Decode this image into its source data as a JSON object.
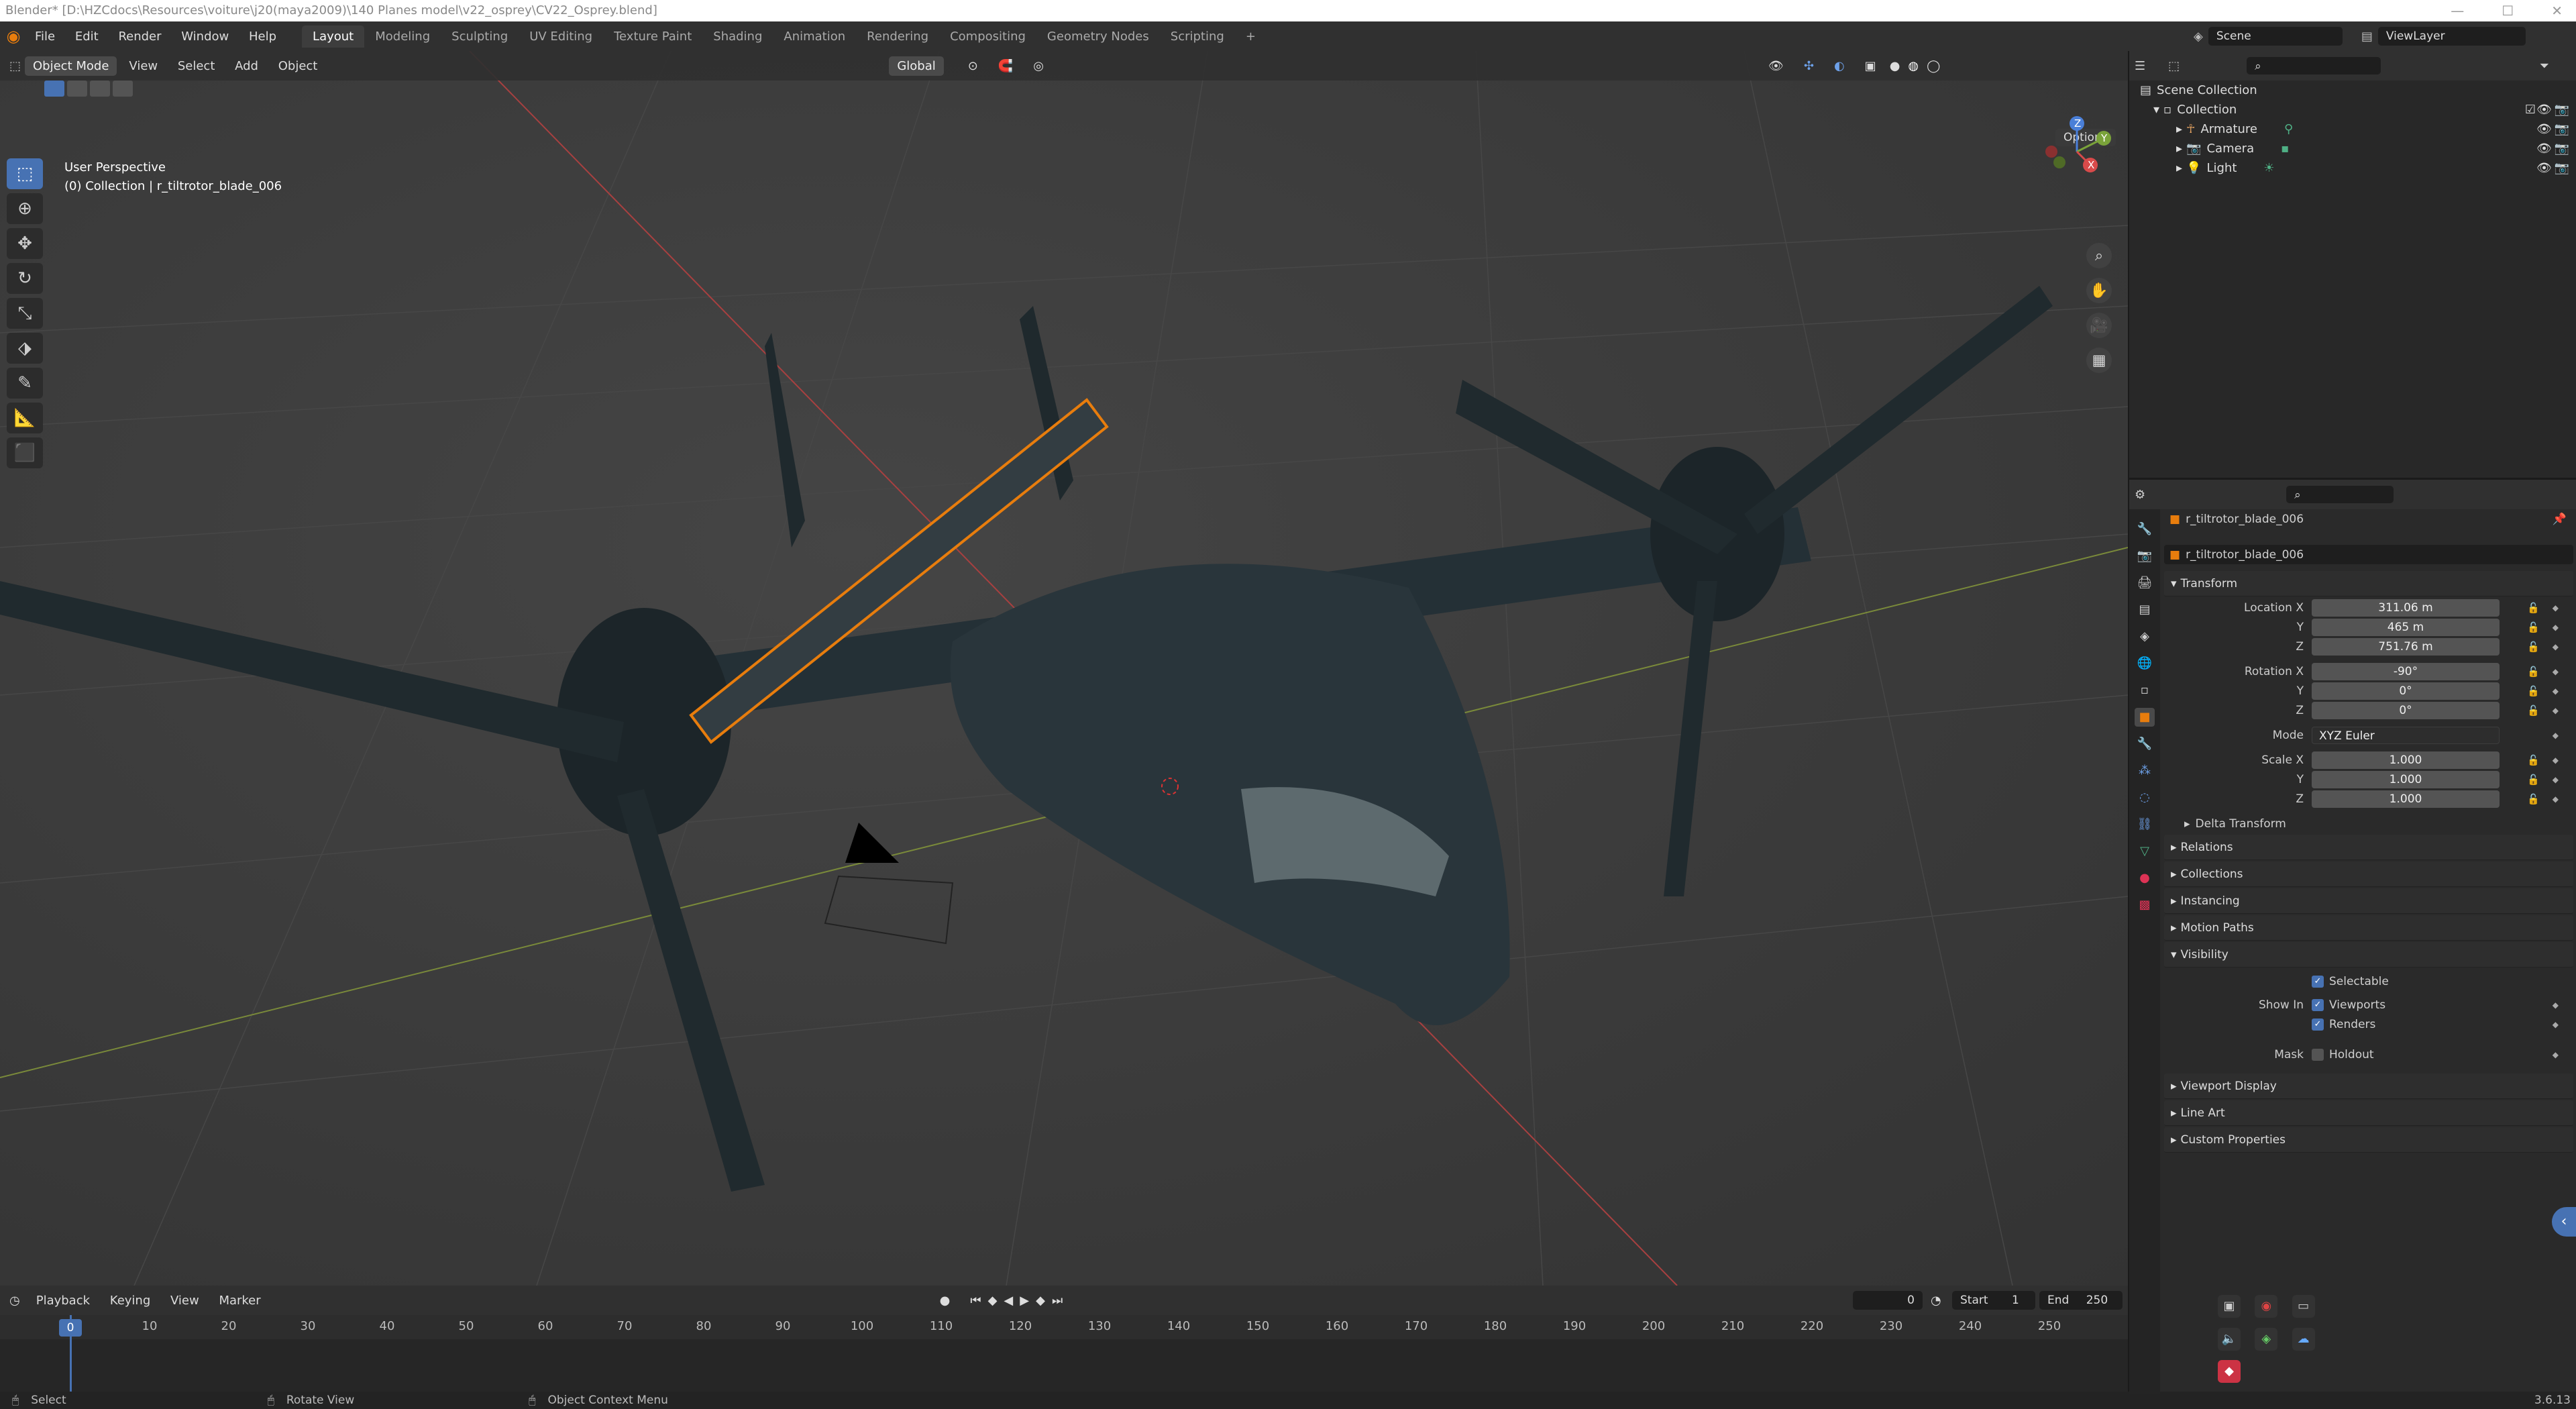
{
  "window": {
    "title": "Blender* [D:\\HZCdocs\\Resources\\voiture\\j20(maya2009)\\140 Planes model\\v22_osprey\\CV22_Osprey.blend]"
  },
  "menu": [
    "File",
    "Edit",
    "Render",
    "Window",
    "Help"
  ],
  "workspaces": [
    "Layout",
    "Modeling",
    "Sculpting",
    "UV Editing",
    "Texture Paint",
    "Shading",
    "Animation",
    "Rendering",
    "Compositing",
    "Geometry Nodes",
    "Scripting"
  ],
  "scene": {
    "name": "Scene",
    "view_layer": "ViewLayer"
  },
  "viewport_header": {
    "mode": "Object Mode",
    "menus": [
      "View",
      "Select",
      "Add",
      "Object"
    ],
    "orientation": "Global",
    "options": "Options"
  },
  "viewport_info": {
    "perspective": "User Perspective",
    "collection": "(0) Collection | r_tiltrotor_blade_006"
  },
  "gizmo": {
    "x": "X",
    "y": "Y",
    "z": "Z"
  },
  "outliner": {
    "root": "Scene Collection",
    "collection": "Collection",
    "items": [
      "Armature",
      "Camera",
      "Light"
    ]
  },
  "properties": {
    "object_name": "r_tiltrotor_blade_006",
    "data_name": "r_tiltrotor_blade_006",
    "transform": {
      "title": "Transform",
      "location_label": "Location X",
      "loc": [
        "311.06 m",
        "465 m",
        "751.76 m"
      ],
      "rotation_label": "Rotation X",
      "rot": [
        "-90°",
        "0°",
        "0°"
      ],
      "mode_label": "Mode",
      "mode": "XYZ Euler",
      "scale_label": "Scale X",
      "scale": [
        "1.000",
        "1.000",
        "1.000"
      ],
      "y": "Y",
      "z": "Z"
    },
    "delta": "Delta Transform",
    "panels": [
      "Relations",
      "Collections",
      "Instancing",
      "Motion Paths"
    ],
    "visibility": {
      "title": "Visibility",
      "selectable": "Selectable",
      "show_in": "Show In",
      "viewports": "Viewports",
      "renders": "Renders",
      "mask": "Mask",
      "holdout": "Holdout"
    },
    "panels2": [
      "Viewport Display",
      "Line Art",
      "Custom Properties"
    ]
  },
  "timeline": {
    "menus": [
      "Playback",
      "Keying",
      "View",
      "Marker"
    ],
    "current_frame": "0",
    "start_label": "Start",
    "start": "1",
    "end_label": "End",
    "end": "250",
    "ticks": [
      "0",
      "10",
      "20",
      "30",
      "40",
      "50",
      "60",
      "70",
      "80",
      "90",
      "100",
      "110",
      "120",
      "130",
      "140",
      "150",
      "160",
      "170",
      "180",
      "190",
      "200",
      "210",
      "220",
      "230",
      "240",
      "250"
    ]
  },
  "status": {
    "select": "Select",
    "rotate": "Rotate View",
    "context": "Object Context Menu",
    "version": "3.6.13"
  },
  "colors": {
    "accent": "#4772b3",
    "selection": "#e87d0d",
    "background": "#3a3a3a"
  }
}
